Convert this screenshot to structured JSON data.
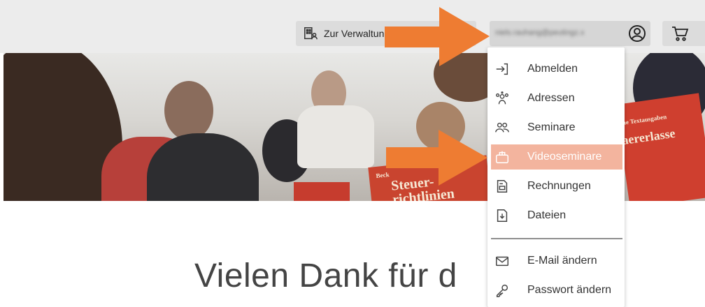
{
  "header": {
    "admin_button_label": "Zur Verwaltung",
    "email_blurred": "niels.rauhang@peutingz.x"
  },
  "user_menu": {
    "items": [
      {
        "label": "Abmelden",
        "icon": "logout-icon"
      },
      {
        "label": "Adressen",
        "icon": "addresses-icon"
      },
      {
        "label": "Seminare",
        "icon": "seminars-icon"
      },
      {
        "label": "Videoseminare",
        "icon": "video-seminars-icon",
        "active": true
      },
      {
        "label": "Rechnungen",
        "icon": "invoices-icon"
      },
      {
        "label": "Dateien",
        "icon": "files-icon"
      },
      {
        "label": "E-Mail ändern",
        "icon": "email-icon"
      },
      {
        "label": "Passwort ändern",
        "icon": "key-icon"
      }
    ]
  },
  "hero": {
    "book1_text_small": "Beck",
    "book1_text_large": "Steuer-\nrichtlinien",
    "book2_text_small": "he Textausgaben",
    "book2_text_large": "aererlasse"
  },
  "main": {
    "heading": "Vielen Dank für d"
  },
  "colors": {
    "accent_arrow": "#ee7c32",
    "active_item_bg": "#f3b49e"
  }
}
